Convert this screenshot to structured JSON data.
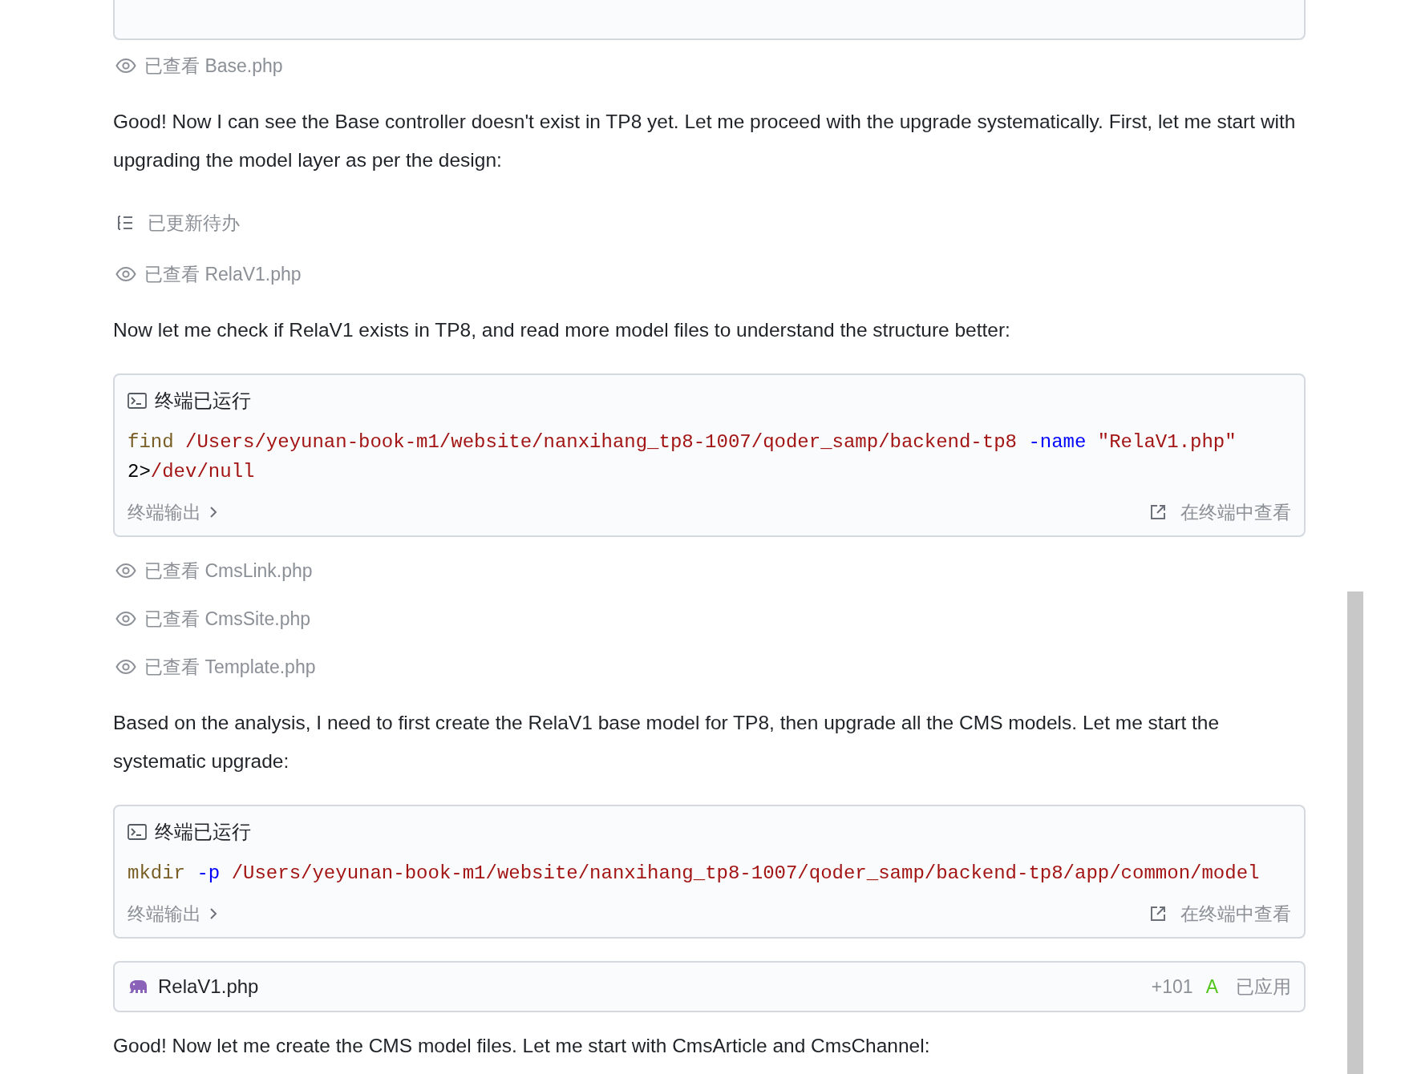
{
  "steps": [
    {
      "kind": "terminal_tail"
    },
    {
      "kind": "viewed",
      "action": "已查看",
      "file": "Base.php"
    },
    {
      "kind": "text",
      "text": "Good! Now I can see the Base controller doesn't exist in TP8 yet. Let me proceed with the upgrade systematically. First, let me start with upgrading the model layer as per the design:"
    },
    {
      "kind": "todo",
      "text": "已更新待办"
    },
    {
      "kind": "viewed",
      "action": "已查看",
      "file": "RelaV1.php"
    },
    {
      "kind": "text",
      "text": "Now let me check if RelaV1 exists in TP8, and read more model files to understand the structure better:"
    },
    {
      "kind": "terminal",
      "title": "终端已运行",
      "tokens": [
        {
          "kind": "cmd",
          "text": "find"
        },
        {
          "kind": "path",
          "text": " /Users/yeyunan-book-m1/website/nanxihang_tp8-1007/qoder_samp/backend-tp8"
        },
        {
          "kind": "flag",
          "text": " -name"
        },
        {
          "kind": "string",
          "text": " \"RelaV1.php\""
        },
        {
          "kind": "plain",
          "text": " 2>"
        },
        {
          "kind": "path",
          "text": "/dev/null"
        }
      ],
      "output_label": "终端输出",
      "open_label": "在终端中查看"
    },
    {
      "kind": "viewed",
      "action": "已查看",
      "file": "CmsLink.php"
    },
    {
      "kind": "viewed",
      "action": "已查看",
      "file": "CmsSite.php"
    },
    {
      "kind": "viewed",
      "action": "已查看",
      "file": "Template.php"
    },
    {
      "kind": "text",
      "text": "Based on the analysis, I need to first create the RelaV1 base model for TP8, then upgrade all the CMS models. Let me start the systematic upgrade:"
    },
    {
      "kind": "terminal",
      "title": "终端已运行",
      "tokens": [
        {
          "kind": "cmd",
          "text": "mkdir"
        },
        {
          "kind": "flag",
          "text": " -p"
        },
        {
          "kind": "path",
          "text": " /Users/yeyunan-book-m1/website/nanxihang_tp8-1007/qoder_samp/backend-tp8/app/common/model"
        }
      ],
      "output_label": "终端输出",
      "open_label": "在终端中查看"
    },
    {
      "kind": "file",
      "file": "RelaV1.php",
      "additions": "+101",
      "status_letter": "A",
      "status": "已应用"
    },
    {
      "kind": "text",
      "text": "Good! Now let me create the CMS model files. Let me start with CmsArticle and CmsChannel:"
    }
  ]
}
